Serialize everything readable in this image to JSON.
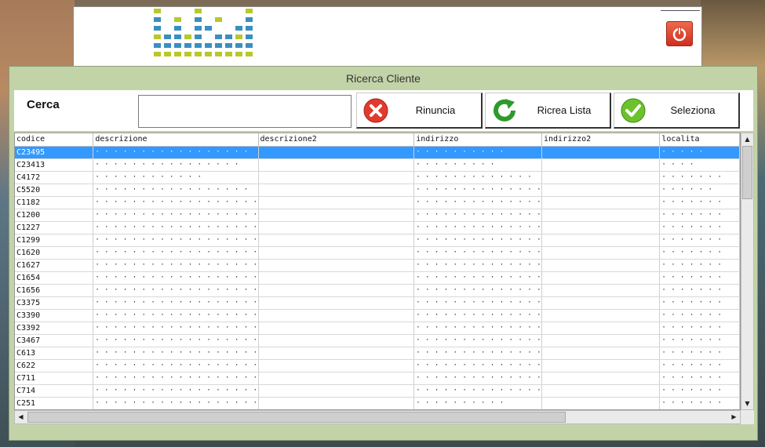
{
  "banner": {
    "power_icon": "power-icon"
  },
  "dialog": {
    "title": "Ricerca Cliente",
    "search_label": "Cerca",
    "search_value": "",
    "buttons": {
      "rinuncia": "Rinuncia",
      "ricrea": "Ricrea Lista",
      "seleziona": "Seleziona"
    }
  },
  "grid": {
    "columns": [
      "codice",
      "descrizione",
      "descrizione2",
      "indirizzo",
      "indirizzo2",
      "localita"
    ],
    "rows": [
      {
        "codice": "C23495",
        "descrizione": "· · · · · · · · ·   · · · · · · · ·",
        "indirizzo": "· · · · · · · · · ·",
        "localita": "· · · · ·",
        "selected": true
      },
      {
        "codice": "C23413",
        "descrizione": "· · · · · · · · · · · · · · · ·",
        "indirizzo": "· · · · · · · · ·",
        "localita": "· · · ·"
      },
      {
        "codice": "C4172",
        "descrizione": "· · · · · · · · · · · ·",
        "indirizzo": "· · · · · · · · · · · · ·",
        "localita": "· · · · · · ·"
      },
      {
        "codice": "C5520",
        "descrizione": "· · · · · · · · · · · · · · · · ·",
        "indirizzo": "· · · · · · · · · · · · · ·",
        "localita": "· · · · · ·"
      },
      {
        "codice": "C1182",
        "descrizione": "· · · · · · · · · · · · · · · · · ·",
        "indirizzo": "· · · · · · · · · · · · · ·",
        "localita": "· · · · · · ·"
      },
      {
        "codice": "C1200",
        "descrizione": "· · · · · · · · · · · · · · · · · ·",
        "indirizzo": "· · · · · · · · · · · · · ·",
        "localita": "· · · · · · ·"
      },
      {
        "codice": "C1227",
        "descrizione": "· · · · · · · · · · · · · · · · · ·",
        "indirizzo": "· · · · · · · · · · · · · ·",
        "localita": "· · · · · · ·"
      },
      {
        "codice": "C1299",
        "descrizione": "· · · · · · · · · · · · · · · · · ·",
        "indirizzo": "· · · · · · · · · · · · · ·",
        "localita": "· · · · · · ·"
      },
      {
        "codice": "C1620",
        "descrizione": "· · · · · · · · · · · · · · · · · ·",
        "indirizzo": "· · · · · · · · · · · · · ·",
        "localita": "· · · · · · ·"
      },
      {
        "codice": "C1627",
        "descrizione": "· · · · · · · · · · · · · · · · · ·",
        "indirizzo": "· · · · · · · · · · · · · ·",
        "localita": "· · · · · · ·"
      },
      {
        "codice": "C1654",
        "descrizione": "· · · · · · · · · · · · · · · · · ·",
        "indirizzo": "· · · · · · · · · · · · · ·",
        "localita": "· · · · · · ·"
      },
      {
        "codice": "C1656",
        "descrizione": "· · · · · · · · · · · · · · · · · ·",
        "indirizzo": "· · · · · · · · · · · · · ·",
        "localita": "· · · · · · ·"
      },
      {
        "codice": "C3375",
        "descrizione": "· · · · · · · · · · · · · · · · · ·",
        "indirizzo": "· · · · · · · · · · · · · ·",
        "localita": "· · · · · · ·"
      },
      {
        "codice": "C3390",
        "descrizione": "· · · · · · · · · · · · · · · · · ·",
        "indirizzo": "· · · · · · · · · · · · · ·",
        "localita": "· · · · · · ·"
      },
      {
        "codice": "C3392",
        "descrizione": "· · · · · · · · · · · · · · · · · ·",
        "indirizzo": "· · · · · · · · · · · · · ·",
        "localita": "· · · · · · ·"
      },
      {
        "codice": "C3467",
        "descrizione": "· · · · · · · · · · · · · · · · · ·",
        "indirizzo": "· · · · · · · · · · · · · ·",
        "localita": "· · · · · · ·"
      },
      {
        "codice": "C613",
        "descrizione": "· · · · · · · · · · · · · · · · · ·",
        "indirizzo": "· · · · · · · · · · · · · ·",
        "localita": "· · · · · · ·"
      },
      {
        "codice": "C622",
        "descrizione": "· · · · · · · · · · · · · · · · · ·",
        "indirizzo": "· · · · · · · · · · · · · ·",
        "localita": "· · · · · · ·"
      },
      {
        "codice": "C711",
        "descrizione": "· · · · · · · · · · · · · · · · · ·",
        "indirizzo": "· · · · · · · · · · · · · ·",
        "localita": "· · · · · · ·"
      },
      {
        "codice": "C714",
        "descrizione": "· · · · · · · · · · · · · · · · · ·",
        "indirizzo": "· · · · · · · · · · · · · ·",
        "localita": "· · · · · · ·"
      },
      {
        "codice": "C251",
        "descrizione": "· · · · · · · · · · · · · · · · · ·",
        "indirizzo": "· · · · · · · · · ·",
        "localita": "· · · · · · ·"
      }
    ]
  },
  "colors": {
    "dialog_bg": "#c3d3a8",
    "selected_row": "#3399ff",
    "logo_blue": "#3b8fbf",
    "logo_yellow": "#b9c72a"
  }
}
